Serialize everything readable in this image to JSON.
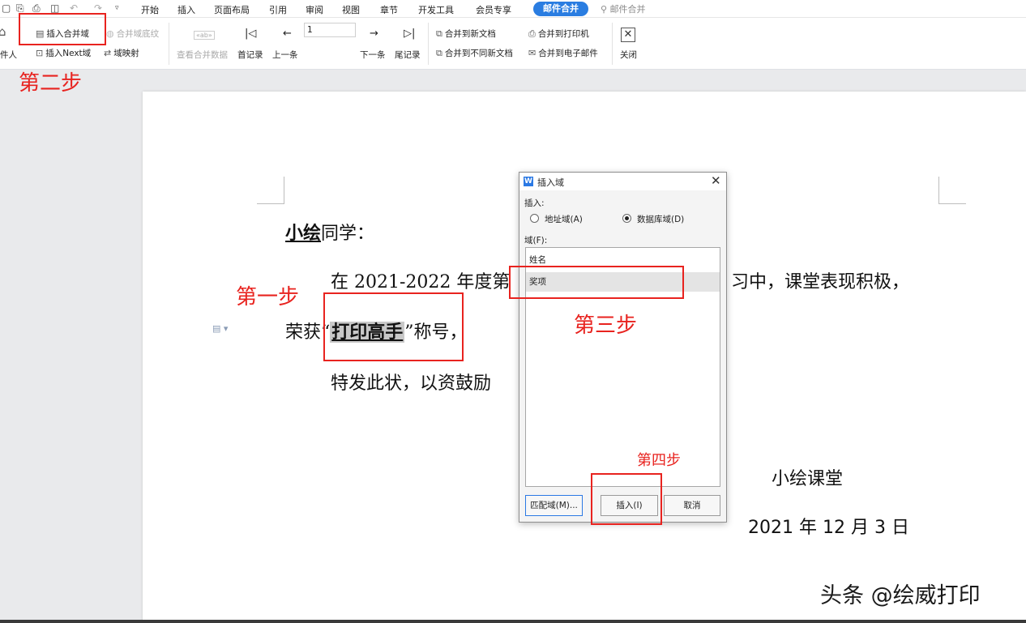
{
  "menubar": {
    "items": [
      "开始",
      "插入",
      "页面布局",
      "引用",
      "审阅",
      "视图",
      "章节",
      "开发工具",
      "会员专享"
    ],
    "active": "邮件合并",
    "search": "邮件合并"
  },
  "ribbon": {
    "recipient_label": "件人",
    "insert_merge_field": "插入合并域",
    "merge_field_shading": "合并域底纹",
    "insert_next_field": "插入Next域",
    "field_mapping": "域映射",
    "view_merge_data": "查看合并数据",
    "view_badge": "«ab»",
    "first_record": "首记录",
    "prev_record": "上一条",
    "record_number": "1",
    "next_record": "下一条",
    "last_record": "尾记录",
    "merge_new_doc": "合并到新文档",
    "merge_separate_docs": "合并到不同新文档",
    "merge_printer": "合并到打印机",
    "merge_email": "合并到电子邮件",
    "close": "关闭"
  },
  "annotations": {
    "step1": "第一步",
    "step2": "第二步",
    "step3": "第三步",
    "step4": "第四步"
  },
  "document": {
    "salutation_name": "小绘",
    "salutation_rest": "同学：",
    "line1_left": "在 2021-2022 年度",
    "line1_partial": "第",
    "line1_right": "习中，课堂表现积极，",
    "line2_left": "荣获",
    "open_quote": "“",
    "award_field": "打印高手",
    "close_quote": "”",
    "line2_right": "称号，",
    "line3": "特发此状，以资鼓励",
    "signature": "小绘课堂",
    "date": "2021 年 12 月 3 日"
  },
  "dialog": {
    "title": "插入域",
    "insert_label": "插入:",
    "radio_address": "地址域(A)",
    "radio_database": "数据库域(D)",
    "fields_label": "域(F):",
    "fields": [
      "姓名",
      "奖项"
    ],
    "selected_field": "奖项",
    "btn_match": "匹配域(M)...",
    "btn_insert": "插入(I)",
    "btn_cancel": "取消"
  },
  "watermark": "头条 @绘威打印",
  "colors": {
    "accent": "#2a7de1",
    "annotation": "#e8231f"
  }
}
